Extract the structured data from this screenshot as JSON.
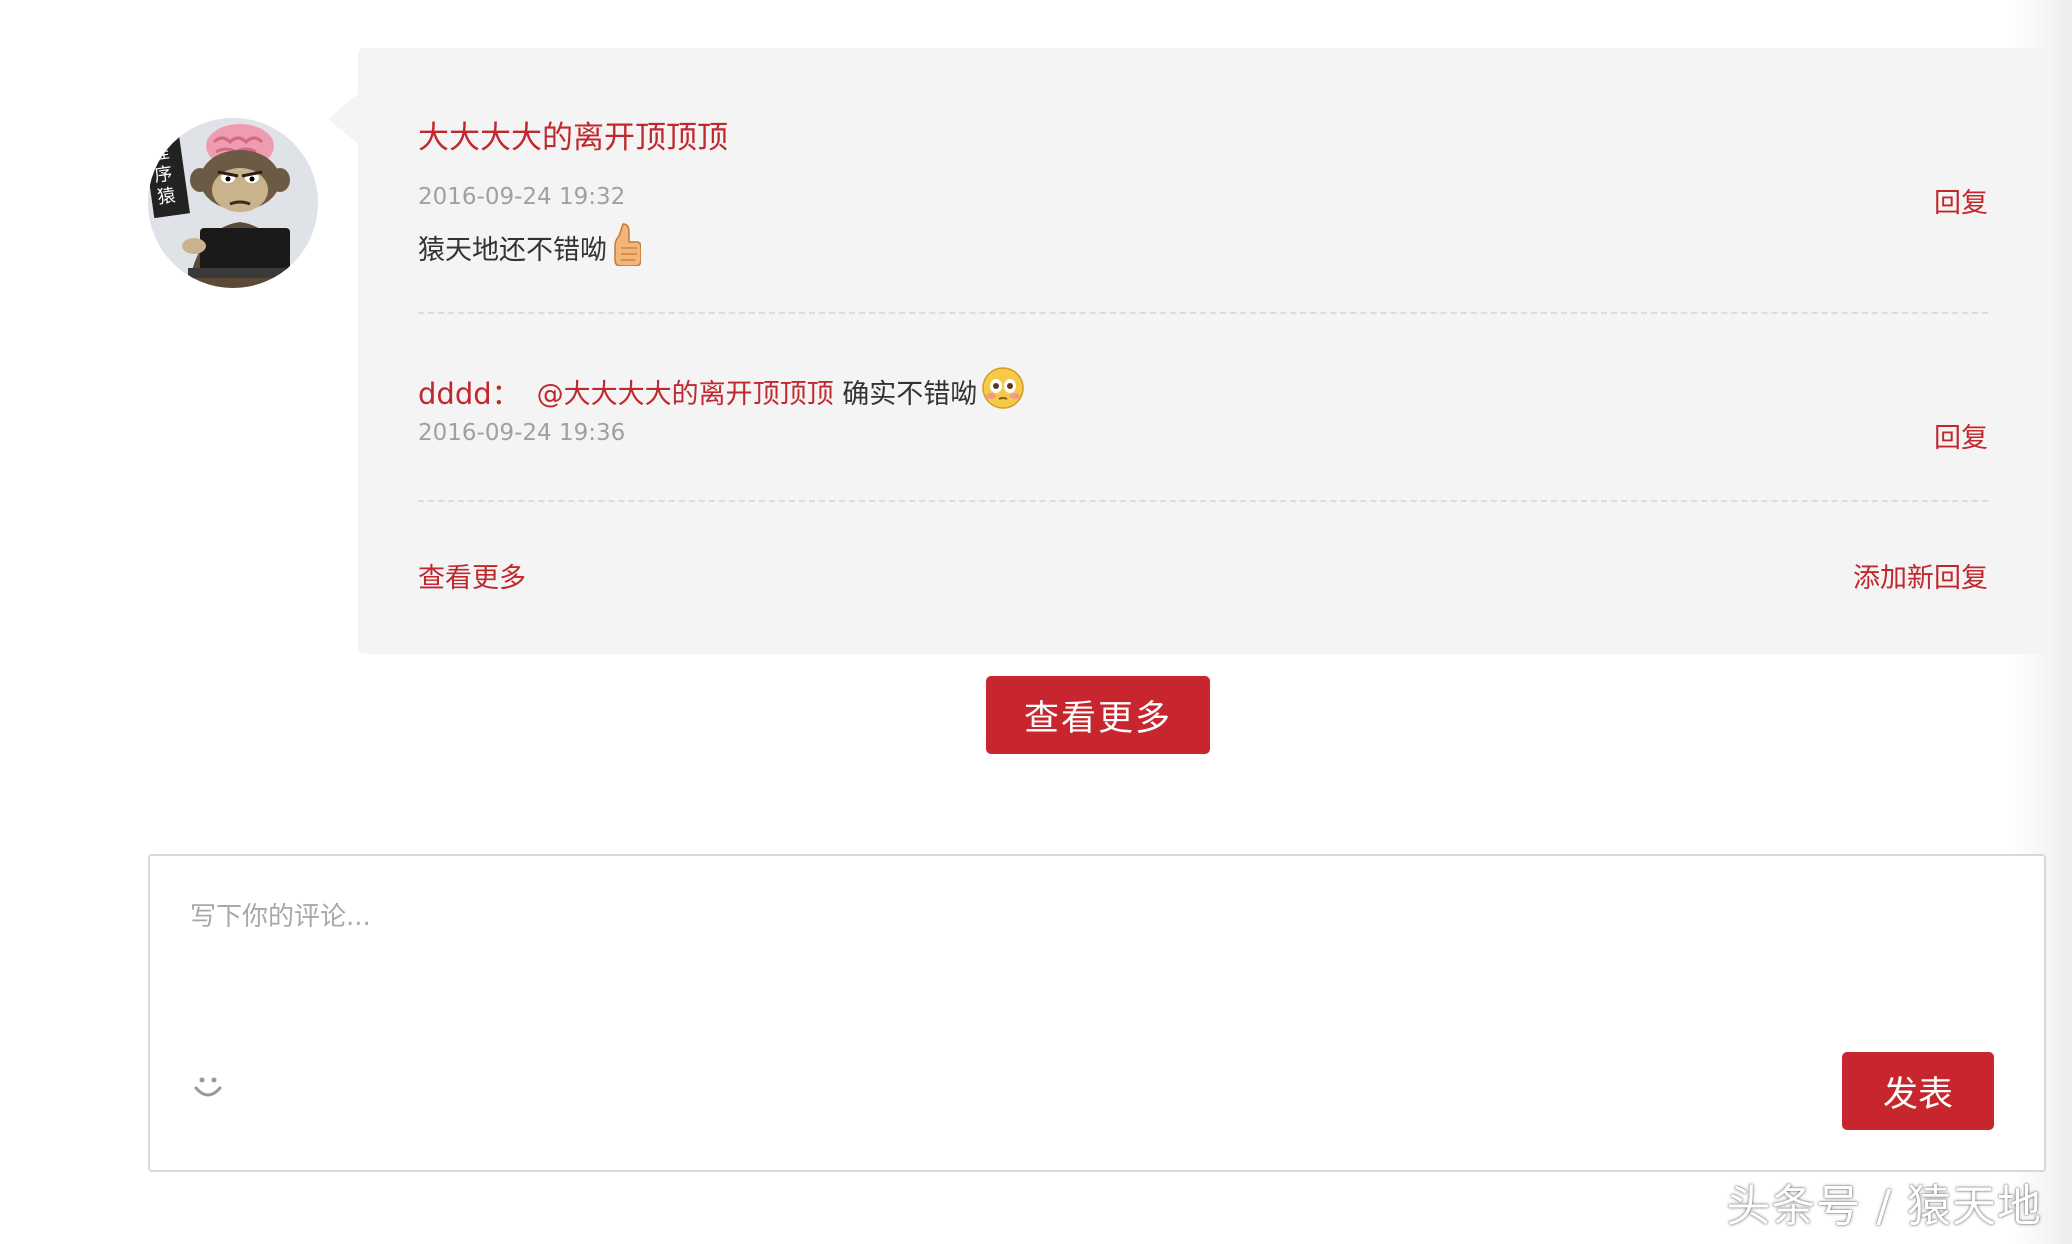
{
  "comment": {
    "author": "大大大大的离开顶顶顶",
    "time": "2016-09-24 19:32",
    "reply_label": "回复",
    "text": "猿天地还不错呦",
    "emoji": "thumbs-up"
  },
  "sub_reply": {
    "author": "dddd：",
    "mention": "@大大大大的离开顶顶顶",
    "text": " 确实不错呦",
    "emoji": "shy-face",
    "time": "2016-09-24 19:36",
    "reply_label": "回复"
  },
  "comment_footer": {
    "view_more_label": "查看更多",
    "add_reply_label": "添加新回复"
  },
  "load_more_button": "查看更多",
  "editor": {
    "placeholder": "写下你的评论...",
    "submit_label": "发表"
  },
  "watermark": "头条号 / 猿天地",
  "colors": {
    "accent": "#c8262e",
    "link": "#c0282e",
    "comment_bg": "#f4f4f4",
    "muted": "#a0a0a0"
  }
}
